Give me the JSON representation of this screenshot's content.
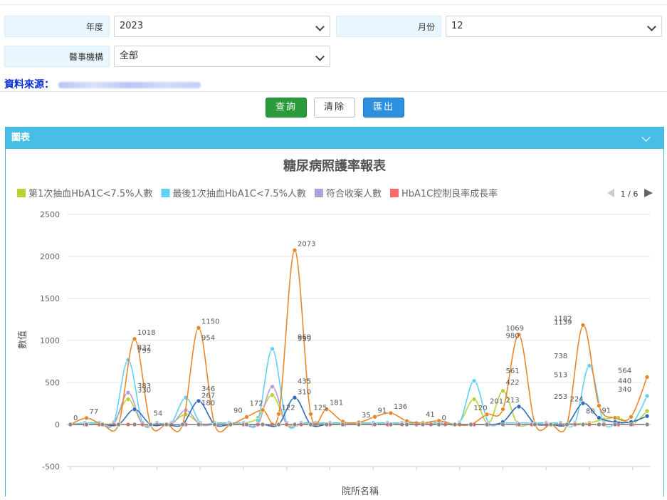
{
  "filters": {
    "year_label": "年度",
    "year_value": "2023",
    "month_label": "月份",
    "month_value": "12",
    "org_label": "醫事機構",
    "org_value": "全部"
  },
  "source_label": "資料來源：",
  "buttons": {
    "query": "查詢",
    "clear": "清除",
    "export": "匯出"
  },
  "panel_title": "圖表",
  "colors": {
    "panel_header": "#48bde6",
    "query_btn": "#2a9b3a",
    "export_btn": "#2d8fe0",
    "source_text": "#0b2fd6"
  },
  "chart_data": {
    "type": "line",
    "title": "糖尿病照護率報表",
    "xlabel": "院所名稱",
    "ylabel": "數值",
    "ylim": [
      -500,
      2500
    ],
    "yticks": [
      -500,
      0,
      500,
      1000,
      1500,
      2000,
      2500
    ],
    "legend_page": "1 / 6",
    "legend_position": "top",
    "x_count": 29,
    "series": [
      {
        "name": "第1次抽血HbA1C<7.5%人數",
        "color": "#b5d433",
        "in_legend": true,
        "values": [
          0,
          5,
          10,
          30,
          300,
          10,
          10,
          20,
          120,
          10,
          10,
          20,
          20,
          80,
          350,
          10,
          10,
          10,
          10,
          10,
          10,
          10,
          10,
          10,
          5,
          10,
          15,
          30,
          300,
          10,
          400,
          10,
          10,
          20,
          10,
          10,
          20,
          60,
          80,
          10,
          160
        ]
      },
      {
        "name": "最後1次抽血HbA1C<7.5%人數",
        "color": "#5fd1f5",
        "in_legend": true,
        "values": [
          0,
          20,
          20,
          20,
          770,
          20,
          20,
          20,
          320,
          20,
          20,
          20,
          20,
          50,
          900,
          20,
          20,
          20,
          20,
          20,
          20,
          20,
          20,
          20,
          20,
          20,
          20,
          20,
          520,
          20,
          20,
          20,
          20,
          20,
          20,
          20,
          700,
          20,
          20,
          20,
          340
        ]
      },
      {
        "name": "符合收案人數",
        "color": "#b39ddb",
        "in_legend": true,
        "values": [
          0,
          0,
          0,
          0,
          380,
          0,
          0,
          0,
          170,
          0,
          0,
          0,
          0,
          0,
          450,
          0,
          0,
          0,
          0,
          0,
          0,
          0,
          0,
          0,
          0,
          0,
          0,
          0,
          0,
          0,
          0,
          0,
          0,
          0,
          0,
          0,
          0,
          0,
          0,
          0,
          0
        ]
      },
      {
        "name": "HbA1C控制良率成長率",
        "color": "#f76a6a",
        "in_legend": true,
        "values": [
          0,
          0,
          0,
          0,
          0,
          0,
          0,
          0,
          0,
          0,
          0,
          0,
          0,
          0,
          0,
          0,
          0,
          0,
          0,
          0,
          0,
          0,
          0,
          0,
          0,
          0,
          0,
          0,
          0,
          0,
          0,
          0,
          0,
          0,
          0,
          0,
          0,
          0,
          0,
          0,
          0
        ]
      },
      {
        "name": "",
        "color": "#e8872a",
        "in_legend": false,
        "values": [
          0,
          77,
          0,
          0,
          1018,
          0,
          0,
          0,
          1150,
          0,
          0,
          90,
          172,
          125,
          2073,
          125,
          181,
          35,
          25,
          91,
          136,
          41,
          18,
          44,
          0,
          0,
          120,
          181,
          1069,
          10,
          0,
          0,
          1182,
          224,
          80,
          91,
          564
        ]
      },
      {
        "name": "",
        "color": "#2f6bb8",
        "in_legend": false,
        "values": [
          0,
          0,
          0,
          0,
          180,
          0,
          0,
          0,
          280,
          0,
          0,
          0,
          0,
          0,
          320,
          0,
          0,
          0,
          0,
          0,
          0,
          0,
          0,
          0,
          0,
          0,
          0,
          30,
          213,
          10,
          0,
          0,
          253,
          80,
          30,
          30,
          100
        ]
      },
      {
        "name": "",
        "color": "#8a8a8a",
        "in_legend": false,
        "values": [
          0,
          0,
          0,
          0,
          0,
          0,
          0,
          0,
          0,
          0,
          0,
          0,
          0,
          0,
          0,
          0,
          0,
          0,
          0,
          0,
          0,
          0,
          0,
          0,
          0,
          0,
          0,
          0,
          0,
          0,
          0,
          0,
          0,
          0,
          0,
          0,
          0
        ]
      }
    ],
    "data_labels": [
      {
        "xi": 0,
        "y": 0,
        "text": "0"
      },
      {
        "xi": 1,
        "y": 77,
        "text": "77"
      },
      {
        "xi": 4,
        "y": 1018,
        "text": "1018"
      },
      {
        "xi": 4,
        "y": 837,
        "text": "837"
      },
      {
        "xi": 4,
        "y": 799,
        "text": "799"
      },
      {
        "xi": 4,
        "y": 383,
        "text": "383"
      },
      {
        "xi": 4,
        "y": 330,
        "text": "330"
      },
      {
        "xi": 5,
        "y": 54,
        "text": "54"
      },
      {
        "xi": 8,
        "y": 1150,
        "text": "1150"
      },
      {
        "xi": 8,
        "y": 954,
        "text": "954"
      },
      {
        "xi": 8,
        "y": 346,
        "text": "346"
      },
      {
        "xi": 8,
        "y": 267,
        "text": "267"
      },
      {
        "xi": 8,
        "y": 180,
        "text": "180"
      },
      {
        "xi": 10,
        "y": 90,
        "text": "90"
      },
      {
        "xi": 11,
        "y": 172,
        "text": "172"
      },
      {
        "xi": 13,
        "y": 122,
        "text": "122"
      },
      {
        "xi": 14,
        "y": 2073,
        "text": "2073"
      },
      {
        "xi": 14,
        "y": 960,
        "text": "960"
      },
      {
        "xi": 14,
        "y": 939,
        "text": "939"
      },
      {
        "xi": 14,
        "y": 435,
        "text": "435"
      },
      {
        "xi": 14,
        "y": 310,
        "text": "310"
      },
      {
        "xi": 15,
        "y": 125,
        "text": "125"
      },
      {
        "xi": 16,
        "y": 181,
        "text": "181"
      },
      {
        "xi": 18,
        "y": 35,
        "text": "35"
      },
      {
        "xi": 19,
        "y": 91,
        "text": "91"
      },
      {
        "xi": 20,
        "y": 136,
        "text": "136"
      },
      {
        "xi": 22,
        "y": 41,
        "text": "41"
      },
      {
        "xi": 23,
        "y": 0,
        "text": "0"
      },
      {
        "xi": 25,
        "y": 120,
        "text": "120"
      },
      {
        "xi": 26,
        "y": 201,
        "text": "201"
      },
      {
        "xi": 27,
        "y": 1069,
        "text": "1069"
      },
      {
        "xi": 27,
        "y": 980,
        "text": "980"
      },
      {
        "xi": 27,
        "y": 561,
        "text": "561"
      },
      {
        "xi": 27,
        "y": 422,
        "text": "422"
      },
      {
        "xi": 27,
        "y": 213,
        "text": "213"
      },
      {
        "xi": 30,
        "y": 1182,
        "text": "1182"
      },
      {
        "xi": 30,
        "y": 1139,
        "text": "1139"
      },
      {
        "xi": 30,
        "y": 738,
        "text": "738"
      },
      {
        "xi": 30,
        "y": 513,
        "text": "513"
      },
      {
        "xi": 30,
        "y": 253,
        "text": "253"
      },
      {
        "xi": 31,
        "y": 224,
        "text": "224"
      },
      {
        "xi": 32,
        "y": 80,
        "text": "80"
      },
      {
        "xi": 33,
        "y": 91,
        "text": "91"
      },
      {
        "xi": 34,
        "y": 564,
        "text": "564"
      },
      {
        "xi": 34,
        "y": 440,
        "text": "440"
      },
      {
        "xi": 34,
        "y": 340,
        "text": "340"
      }
    ]
  }
}
